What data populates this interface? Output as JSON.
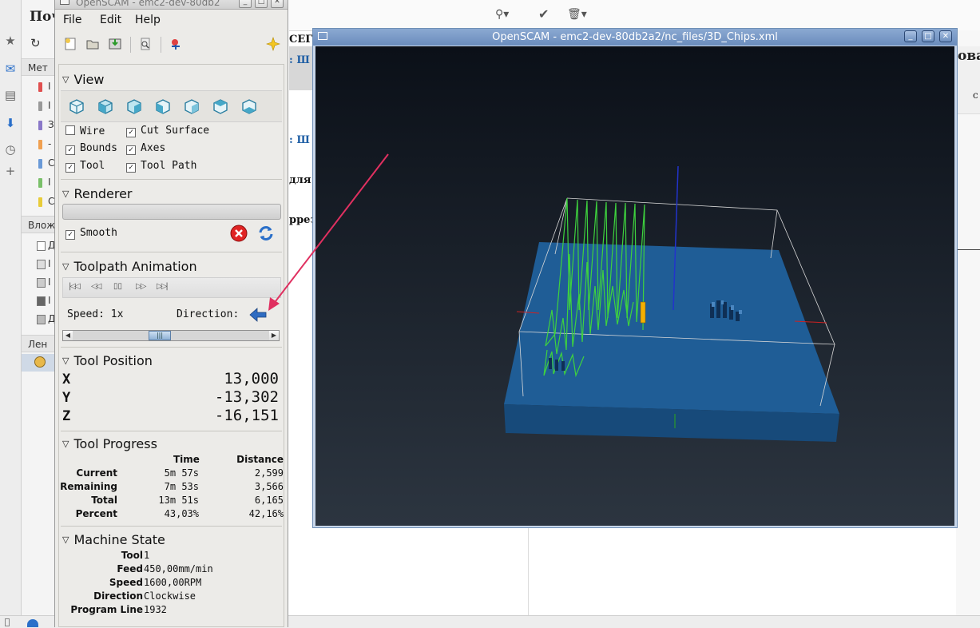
{
  "background_app": {
    "page_title": "Поч",
    "folder_header_1": "Мет",
    "folder_header_2": "Влож",
    "folder_header_3": "Лен",
    "folder_letters": [
      "I",
      "I",
      "З",
      "-",
      "С",
      "I",
      "С"
    ],
    "attach_letters": [
      "Д",
      "I",
      "I",
      "I",
      "Д"
    ],
    "content_snippets": {
      "header_fragment": "СЕГ",
      "link_fragment_1": ": Ш",
      "link_fragment_2": ": Ш",
      "text_fragment_1": "для",
      "text_fragment_2": "ррез",
      "right_fragment": "ова",
      "right_fragment_2": "с"
    },
    "colors": {
      "tag_red": "#e05050",
      "tag_gray": "#9a9a9a",
      "tag_purple": "#8a78c8",
      "tag_orange": "#f0a050",
      "tag_blue": "#6a9ad8",
      "tag_green": "#7ac06a",
      "tag_yellow": "#e8cc3a"
    }
  },
  "controls_window": {
    "title": "OpenSCAM - emc2-dev-80db2",
    "menu": {
      "file": "File",
      "edit": "Edit",
      "help": "Help"
    },
    "view": {
      "heading": "View",
      "options": [
        {
          "label": "Wire",
          "checked": false
        },
        {
          "label": "Cut Surface",
          "checked": true
        },
        {
          "label": "Bounds",
          "checked": true
        },
        {
          "label": "Axes",
          "checked": true
        },
        {
          "label": "Tool",
          "checked": true
        },
        {
          "label": "Tool Path",
          "checked": true
        }
      ]
    },
    "renderer": {
      "heading": "Renderer",
      "smooth_label": "Smooth",
      "smooth_checked": true
    },
    "animation": {
      "heading": "Toolpath Animation",
      "speed_label": "Speed: 1x",
      "direction_label": "Direction:",
      "position_fraction": 0.43
    },
    "tool_position": {
      "heading": "Tool Position",
      "x_label": "X",
      "x_value": "13,000",
      "y_label": "Y",
      "y_value": "-13,302",
      "z_label": "Z",
      "z_value": "-16,151"
    },
    "tool_progress": {
      "heading": "Tool Progress",
      "col_time": "Time",
      "col_distance": "Distance",
      "rows": [
        {
          "label": "Current",
          "time": "5m 57s",
          "distance": "2,599"
        },
        {
          "label": "Remaining",
          "time": "7m 53s",
          "distance": "3,566"
        },
        {
          "label": "Total",
          "time": "13m 51s",
          "distance": "6,165"
        },
        {
          "label": "Percent",
          "time": "43,03%",
          "distance": "42,16%"
        }
      ]
    },
    "machine_state": {
      "heading": "Machine State",
      "rows": [
        {
          "label": "Tool",
          "value": "1"
        },
        {
          "label": "Feed",
          "value": "450,00mm/min"
        },
        {
          "label": "Speed",
          "value": "1600,00RPM"
        },
        {
          "label": "Direction",
          "value": "Clockwise"
        },
        {
          "label": "Program Line",
          "value": "1932"
        }
      ]
    }
  },
  "viewer_window": {
    "title": "OpenSCAM - emc2-dev-80db2a2/nc_files/3D_Chips.xml",
    "colors": {
      "background_top": "#0b1018",
      "background_bottom": "#2c3540",
      "stock": "#1f5d96",
      "toolpath": "#3ed23e",
      "tool": "#f5b000",
      "axis_z": "#2233cc"
    }
  },
  "annotation": {
    "arrow_color": "#e03060"
  }
}
